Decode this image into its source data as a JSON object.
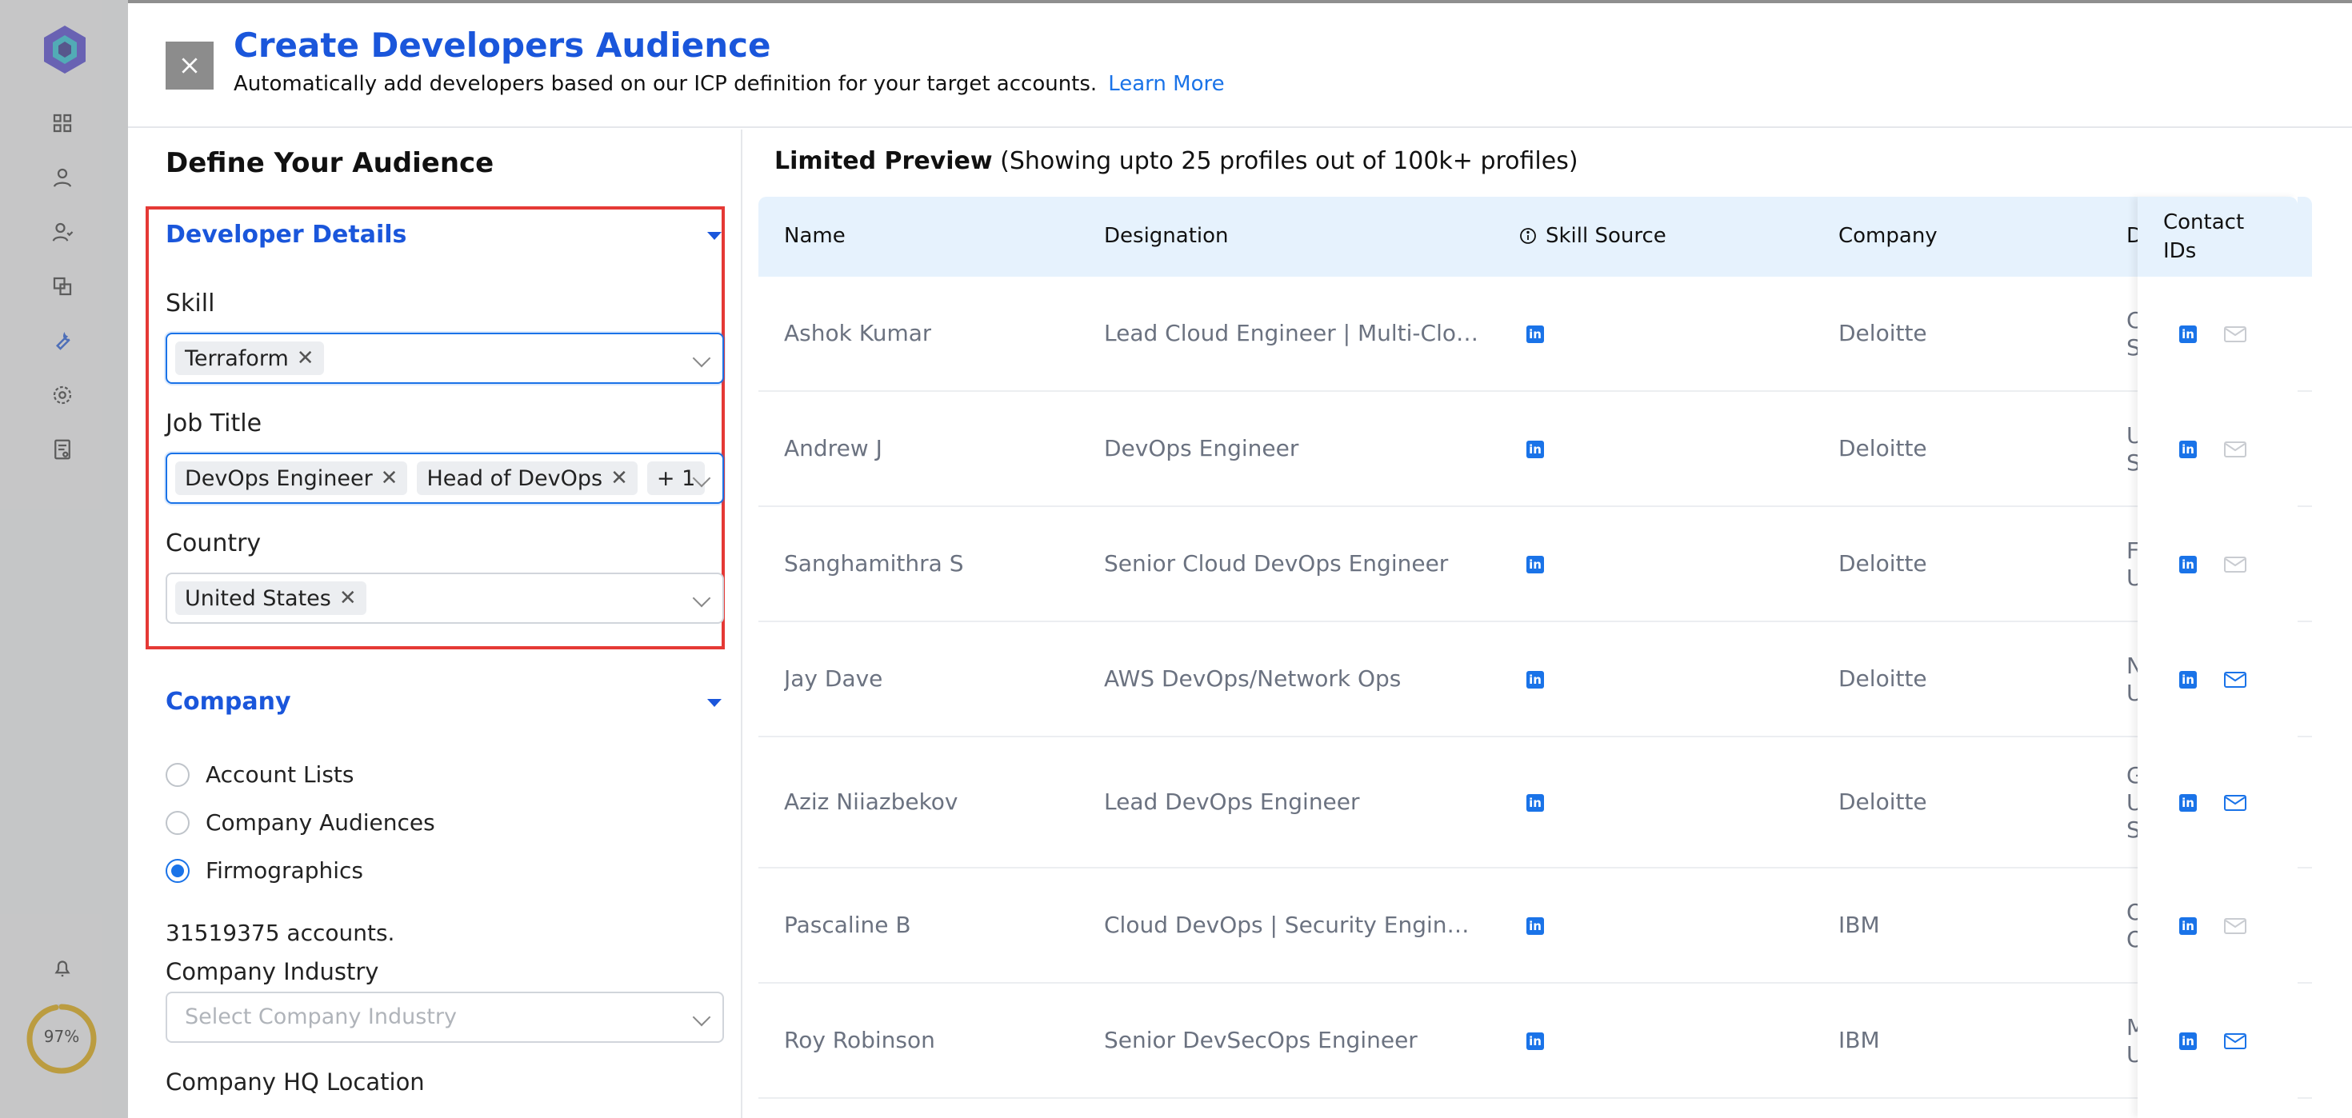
{
  "sidebar": {
    "icons": [
      "grid-icon",
      "user-icon",
      "users-icon",
      "layers-icon",
      "wrench-icon",
      "gear-icon",
      "report-icon",
      "bell-icon"
    ],
    "progress_percent": 97,
    "progress_label": "97%"
  },
  "header": {
    "title": "Create Developers Audience",
    "subtitle": "Automatically add developers based on our ICP definition for your target accounts.",
    "learn_more": "Learn More"
  },
  "left": {
    "section_title": "Define Your Audience",
    "developer_details": {
      "title": "Developer Details",
      "skill_label": "Skill",
      "skill_chips": [
        "Terraform"
      ],
      "job_title_label": "Job Title",
      "job_title_chips": [
        "DevOps Engineer",
        "Head of DevOps"
      ],
      "job_title_more": "+ 1",
      "country_label": "Country",
      "country_chips": [
        "United States"
      ]
    },
    "company": {
      "title": "Company",
      "options": [
        "Account Lists",
        "Company Audiences",
        "Firmographics"
      ],
      "selected": "Firmographics",
      "accounts_count": "31519375 accounts.",
      "industry_label": "Company Industry",
      "industry_placeholder": "Select Company Industry",
      "hq_label": "Company HQ Location"
    }
  },
  "preview": {
    "title_bold": "Limited Preview",
    "title_rest": " (Showing upto 25 profiles out of 100k+ profiles)",
    "columns": [
      "Name",
      "Designation",
      "Skill Source",
      "Company",
      "De",
      "Contact IDs"
    ],
    "rows": [
      {
        "name": "Ashok Kumar",
        "designation": "Lead Cloud Engineer | Multi-Cloud...",
        "company": "Deloitte",
        "location": [
          "Ce",
          "Sta"
        ],
        "email": false
      },
      {
        "name": "Andrew J",
        "designation": "DevOps Engineer",
        "company": "Deloitte",
        "location": [
          "Un",
          "Sta"
        ],
        "email": false
      },
      {
        "name": "Sanghamithra S",
        "designation": "Senior Cloud DevOps Engineer",
        "company": "Deloitte",
        "location": [
          "Fo",
          "Un"
        ],
        "email": false
      },
      {
        "name": "Jay Dave",
        "designation": "AWS DevOps/Network Ops",
        "company": "Deloitte",
        "location": [
          "No",
          "Un"
        ],
        "email": true
      },
      {
        "name": "Aziz Niiazbekov",
        "designation": "Lead DevOps Engineer",
        "company": "Deloitte",
        "location": [
          "Gre",
          "Un",
          "Sta"
        ],
        "email": true
      },
      {
        "name": "Pascaline B",
        "designation": "Cloud DevOps | Security Engineer",
        "company": "IBM",
        "location": [
          "Ok",
          "Ok"
        ],
        "email": false
      },
      {
        "name": "Roy Robinson",
        "designation": "Senior DevSecOps Engineer",
        "company": "IBM",
        "location": [
          "Mo",
          "Un"
        ],
        "email": true
      }
    ],
    "colors": {
      "accent": "#1a73e8",
      "header_bg": "#e6f2fd",
      "highlight": "#e53935"
    }
  }
}
